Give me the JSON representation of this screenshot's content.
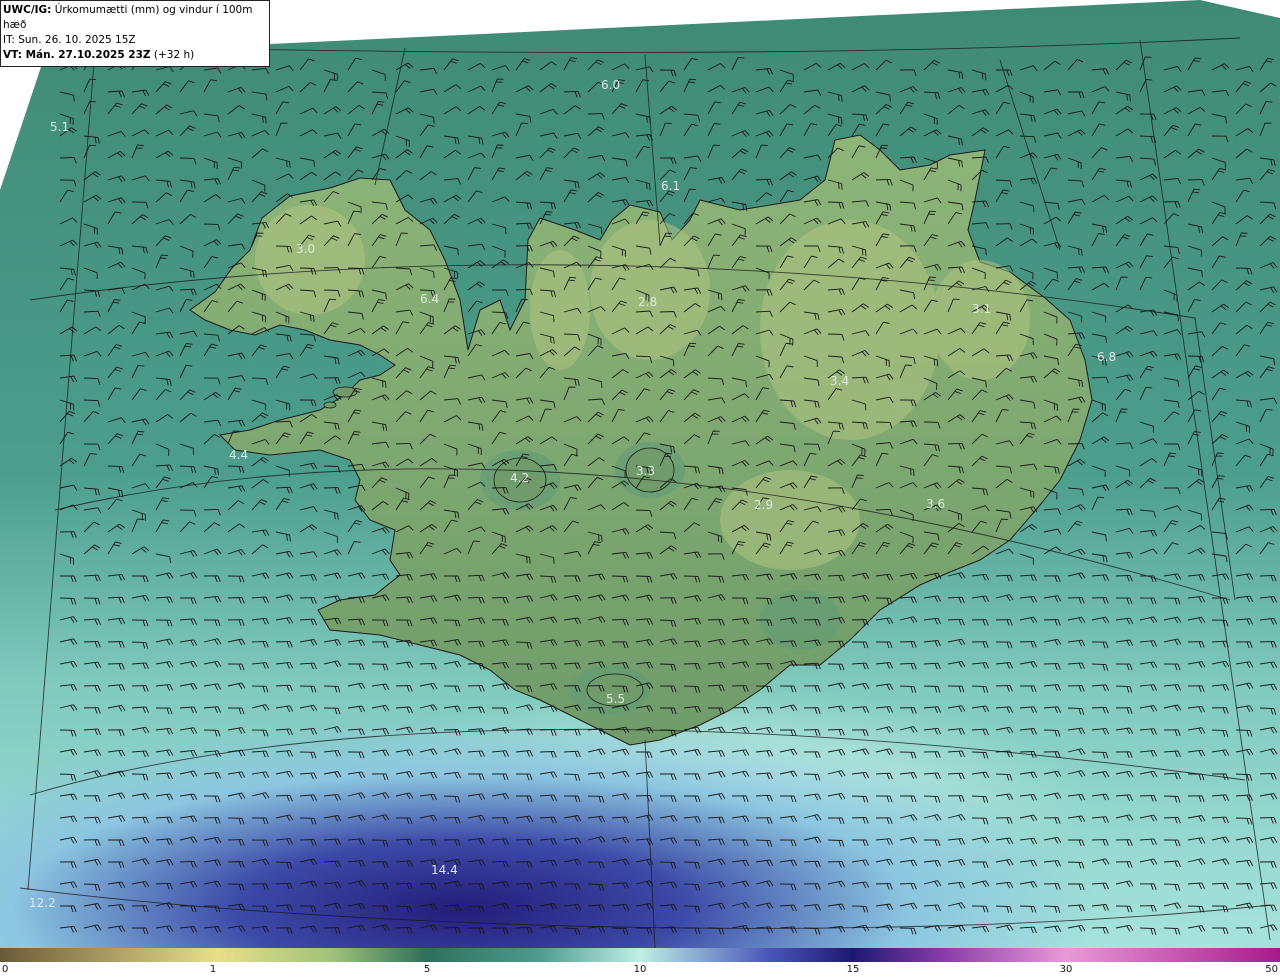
{
  "header": {
    "model_label": "UWC/IG:",
    "title": "Úrkomumætti (mm) og vindur í 100m hæð",
    "initial_time": "IT: Sun. 26. 10. 2025 15Z",
    "valid_label": "VT: Mán. 27.10.2025 23Z",
    "lead_time": "(+32 h)"
  },
  "colorbar": {
    "ticks": [
      "0",
      "1",
      "5",
      "10",
      "15",
      "30",
      "50"
    ],
    "colors": {
      "brown": "#6a5a3a",
      "yellow": "#e8df8c",
      "green_light": "#9fc27a",
      "green_dark": "#2f6f5c",
      "teal": "#4e9a8c",
      "cyan_light": "#bfeee5",
      "blue": "#4a57b8",
      "navy": "#1e1870",
      "purple": "#8b3fa8",
      "pink": "#e89ad6",
      "magenta": "#a61a8a"
    }
  },
  "map_values": [
    {
      "id": "v1",
      "text": "5.1"
    },
    {
      "id": "v2",
      "text": "6.0"
    },
    {
      "id": "v3",
      "text": "6.1"
    },
    {
      "id": "v4",
      "text": "3.0"
    },
    {
      "id": "v5",
      "text": "6.4"
    },
    {
      "id": "v6",
      "text": "2.8"
    },
    {
      "id": "v7",
      "text": "3.1"
    },
    {
      "id": "v8",
      "text": "6.8"
    },
    {
      "id": "v9",
      "text": "3.4"
    },
    {
      "id": "v10",
      "text": "4.4"
    },
    {
      "id": "v11",
      "text": "4.2"
    },
    {
      "id": "v12",
      "text": "3.3"
    },
    {
      "id": "v13",
      "text": "2.9"
    },
    {
      "id": "v14",
      "text": "3.6"
    },
    {
      "id": "v15",
      "text": "5.5"
    },
    {
      "id": "v16",
      "text": "14.4"
    },
    {
      "id": "v17",
      "text": "12.2"
    }
  ]
}
